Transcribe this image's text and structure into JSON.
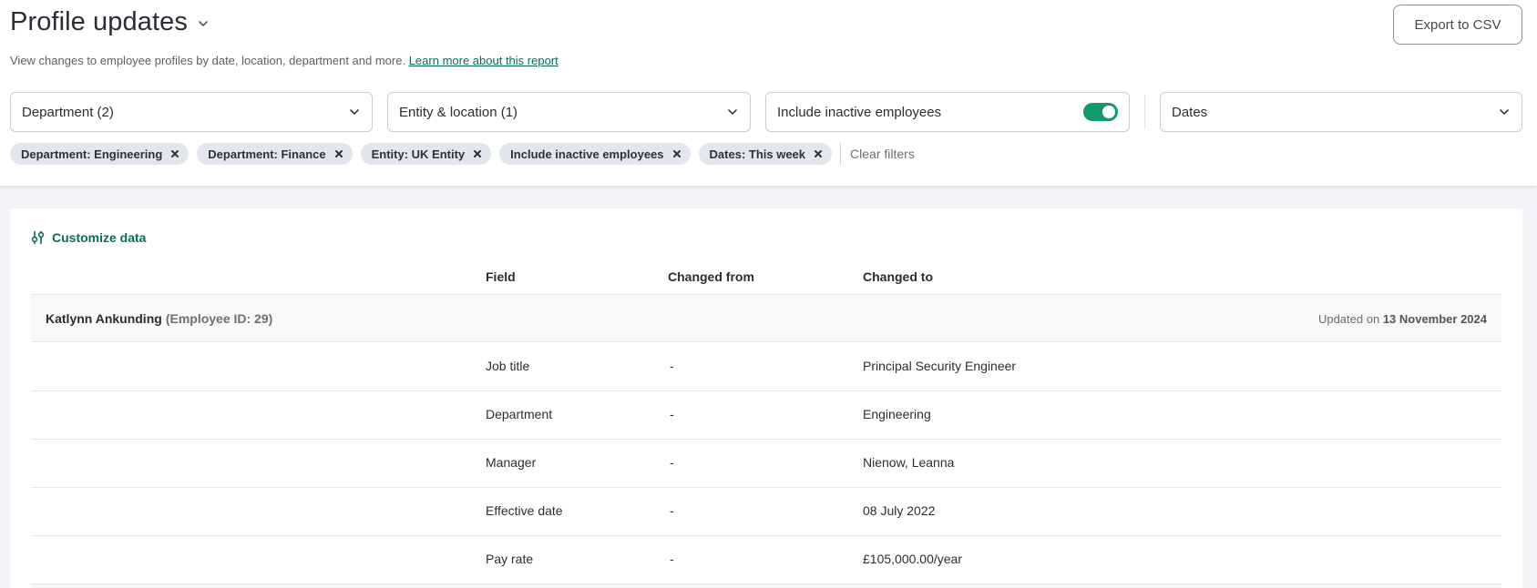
{
  "header": {
    "title": "Profile updates",
    "subtitle": "View changes to employee profiles by date, location, department and more.",
    "learn_more": "Learn more about this report",
    "export_label": "Export to CSV"
  },
  "filters": {
    "department": "Department (2)",
    "entity_location": "Entity & location (1)",
    "include_inactive": "Include inactive employees",
    "include_inactive_on": true,
    "dates": "Dates"
  },
  "chips": [
    "Department: Engineering",
    "Department: Finance",
    "Entity: UK Entity",
    "Include inactive employees",
    "Dates: This week"
  ],
  "clear_filters": "Clear filters",
  "table": {
    "customize_label": "Customize data",
    "columns": [
      "Field",
      "Changed from",
      "Changed to"
    ],
    "employee": {
      "name": "Katlynn Ankunding",
      "id_label": "(Employee ID: 29)",
      "updated_prefix": "Updated on",
      "updated_date": "13 November 2024"
    },
    "rows": [
      {
        "field": "Job title",
        "from": "-",
        "to": "Principal Security Engineer"
      },
      {
        "field": "Department",
        "from": "-",
        "to": "Engineering"
      },
      {
        "field": "Manager",
        "from": "-",
        "to": "Nienow, Leanna"
      },
      {
        "field": "Effective date",
        "from": "-",
        "to": "08 July 2022"
      },
      {
        "field": "Pay rate",
        "from": "-",
        "to": "£105,000.00/year"
      }
    ]
  },
  "colors": {
    "accent": "#0b6b5b",
    "toggle": "#14996f",
    "chip": "#e3e6ec"
  },
  "icons": {
    "title_dropdown": "chevron-down-icon",
    "filter_dropdown": "chevron-down-icon",
    "chip_remove": "close-icon",
    "customize": "sliders-icon"
  }
}
